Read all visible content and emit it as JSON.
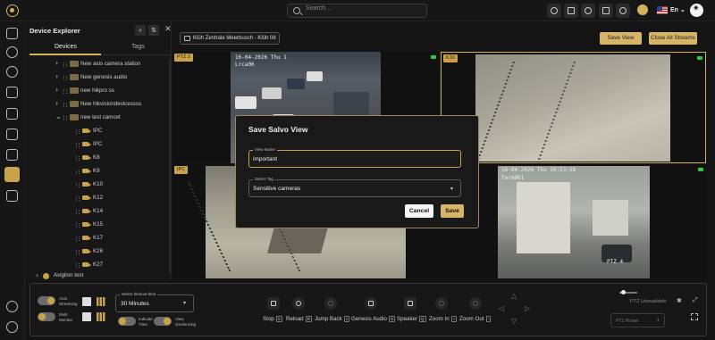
{
  "topbar": {
    "search_placeholder": "Search ...",
    "language": "En"
  },
  "explorer": {
    "title": "Device Explorer",
    "tabs": [
      "Devices",
      "Tags"
    ],
    "tree": [
      {
        "label": "New axis camera station",
        "type": "folder"
      },
      {
        "label": "New genesis audio",
        "type": "folder"
      },
      {
        "label": "new hikpro ss",
        "type": "folder"
      },
      {
        "label": "New hikvisiondevicessss",
        "type": "folder"
      },
      {
        "label": "new test camcet",
        "type": "folder-open"
      },
      {
        "label": "IPC",
        "type": "camera"
      },
      {
        "label": "IPC",
        "type": "camera"
      },
      {
        "label": "K8",
        "type": "camera"
      },
      {
        "label": "K9",
        "type": "camera"
      },
      {
        "label": "K10",
        "type": "camera"
      },
      {
        "label": "K12",
        "type": "camera"
      },
      {
        "label": "K14",
        "type": "camera"
      },
      {
        "label": "K15",
        "type": "camera"
      },
      {
        "label": "K17",
        "type": "camera"
      },
      {
        "label": "K26",
        "type": "camera"
      },
      {
        "label": "K27",
        "type": "camera"
      }
    ],
    "footer_item": "Avigilon test"
  },
  "main": {
    "location": "Klüh Zentrale Meerbusch - Klüh 08",
    "save_view": "Save View",
    "close_all": "Close All Streams",
    "tiles": [
      {
        "badge": "PTZ 2",
        "timestamp": "16-04-2026 Thu 1",
        "sub": "Lrca06"
      },
      {
        "badge": "K10",
        "timestamp": "",
        "sub": ""
      },
      {
        "badge": "IPC",
        "timestamp": "",
        "sub": ""
      },
      {
        "badge": "",
        "timestamp": "16-04-2026 Thu 10:53:58",
        "sub": "ferm061",
        "corner": "PTZ 4"
      }
    ]
  },
  "modal": {
    "title": "Save Salvo View",
    "view_name_label": "View Name",
    "view_name_value": "important",
    "tag_label": "Select Tag",
    "tag_value": "Sensitive cameras",
    "cancel": "Cancel",
    "save": "Save"
  },
  "bottom": {
    "auto_streaming": "Auto Streaming",
    "multi_monitor": "Multi Monitor",
    "timeout_label": "Select timeout time",
    "timeout_value": "30 Minutes",
    "indicate_time": "Indicate Time",
    "view_geofencing": "View Geofencing",
    "controls": [
      {
        "label": "Stop",
        "key": "S"
      },
      {
        "label": "Reload",
        "key": "R"
      },
      {
        "label": "Jump Back",
        "key": "J"
      },
      {
        "label": "Genesis Audio",
        "key": "G"
      },
      {
        "label": "Speaker",
        "key": "Q"
      },
      {
        "label": "Zoom In",
        "key": "+"
      },
      {
        "label": "Zoom Out",
        "key": "-"
      }
    ],
    "ptz_unavailable": "PTZ Unavailable",
    "ptz_preset": "PTZ Preset"
  }
}
